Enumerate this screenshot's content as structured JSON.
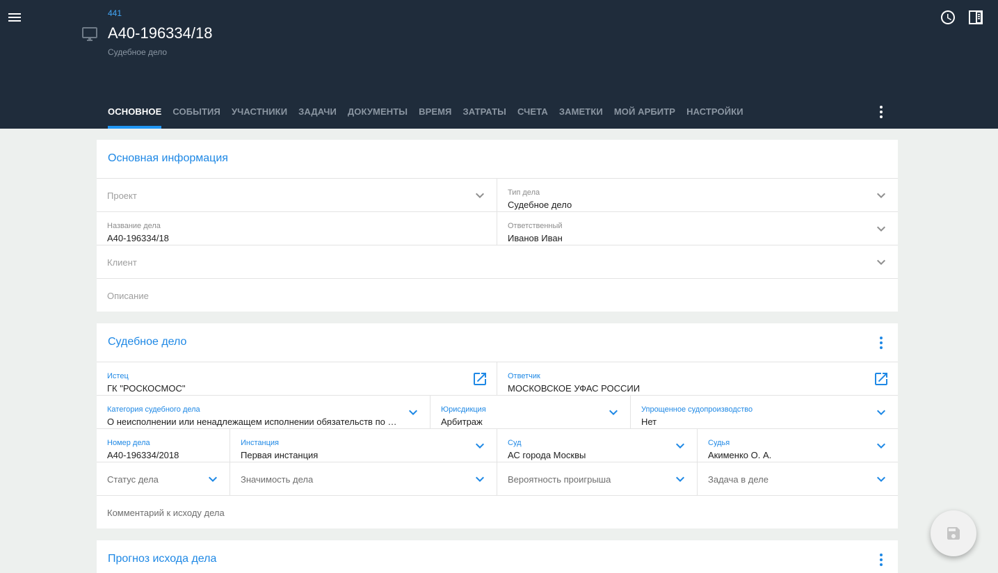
{
  "header": {
    "case_id": "441",
    "title": "А40-196334/18",
    "subtitle": "Судебное дело"
  },
  "tabs": [
    {
      "label": "ОСНОВНОЕ"
    },
    {
      "label": "СОБЫТИЯ"
    },
    {
      "label": "УЧАСТНИКИ"
    },
    {
      "label": "ЗАДАЧИ"
    },
    {
      "label": "ДОКУМЕНТЫ"
    },
    {
      "label": "ВРЕМЯ"
    },
    {
      "label": "ЗАТРАТЫ"
    },
    {
      "label": "СЧЕТА"
    },
    {
      "label": "ЗАМЕТКИ"
    },
    {
      "label": "МОЙ АРБИТР"
    },
    {
      "label": "НАСТРОЙКИ"
    }
  ],
  "main_info": {
    "title": "Основная информация",
    "project_placeholder": "Проект",
    "case_type_label": "Тип дела",
    "case_type_value": "Судебное дело",
    "case_name_label": "Название дела",
    "case_name_value": "А40-196334/18",
    "responsible_label": "Ответственный",
    "responsible_value": "Иванов Иван",
    "client_placeholder": "Клиент",
    "description_placeholder": "Описание"
  },
  "court_case": {
    "title": "Судебное дело",
    "plaintiff_label": "Истец",
    "plaintiff_value": "ГК \"РОСКОСМОС\"",
    "defendant_label": "Ответчик",
    "defendant_value": "МОСКОВСКОЕ УФАС РОССИИ",
    "category_label": "Категория судебного дела",
    "category_value": "О неисполнении или ненадлежащем исполнении обязательств по государственным контрактам",
    "jurisdiction_label": "Юрисдикция",
    "jurisdiction_value": "Арбитраж",
    "simplified_label": "Упрощенное судопроизводство",
    "simplified_value": "Нет",
    "case_number_label": "Номер дела",
    "case_number_value": "А40-196334/2018",
    "instance_label": "Инстанция",
    "instance_value": "Первая инстанция",
    "court_label": "Суд",
    "court_value": "АС города Москвы",
    "judge_label": "Судья",
    "judge_value": "Акименко О. А.",
    "status_placeholder": "Статус дела",
    "importance_placeholder": "Значимость дела",
    "loss_probability_placeholder": "Вероятность проигрыша",
    "task_placeholder": "Задача в деле",
    "comment_placeholder": "Комментарий к исходу дела"
  },
  "forecast": {
    "title": "Прогноз исхода дела"
  },
  "colors": {
    "header_bg": "#1f2c3b",
    "accent": "#1e88e5",
    "tab_indicator": "#2196f3",
    "page_bg": "#edf0ee"
  }
}
